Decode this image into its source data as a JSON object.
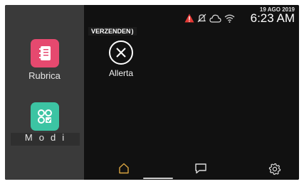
{
  "status": {
    "date": "19 AGO 2019",
    "time": "6:23 AM",
    "icons": [
      "warning-icon",
      "mute-icon",
      "cloud-icon",
      "wifi-icon"
    ],
    "warning_color": "#e53935"
  },
  "banner": {
    "label": "VERZENDEN"
  },
  "sidebar": {
    "items": [
      {
        "label": "Rubrica",
        "icon": "address-book-icon",
        "color": "#e6496f"
      },
      {
        "label": "Modi",
        "icon": "modes-icon",
        "color": "#3cc4a3"
      }
    ]
  },
  "main": {
    "apps": [
      {
        "label": "Allerta",
        "icon": "close-circle-icon"
      }
    ]
  },
  "bottom_nav": {
    "items": [
      {
        "name": "home",
        "icon": "home-icon",
        "active": true,
        "color": "#d9a441"
      },
      {
        "name": "messages",
        "icon": "chat-icon",
        "active": false
      },
      {
        "name": "settings",
        "icon": "gear-icon",
        "active": false
      }
    ]
  }
}
